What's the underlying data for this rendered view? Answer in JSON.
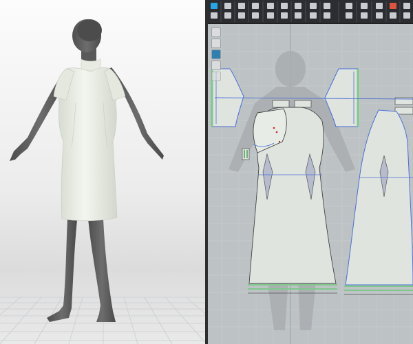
{
  "app": {
    "panels": [
      "3d-viewport",
      "2d-pattern-window"
    ]
  },
  "colors": {
    "viewport_bg_top": "#fcfcfc",
    "viewport_bg_bottom": "#e2e2e2",
    "avatar": "#5f5f5f",
    "garment": "#eef1e9",
    "pattern_bg": "#bdc2c4",
    "pattern_fill": "#dfe4df",
    "seam_blue": "#4a6fd6",
    "binding_green": "#7ec98a",
    "toolbar_bg": "#2b2d30"
  },
  "toolbar": {
    "icons": [
      "transform-pattern-icon",
      "edit-pattern-icon",
      "edit-curve-icon",
      "add-point-icon",
      "polygon-icon",
      "rectangle-icon",
      "circle-icon",
      "internal-polygon-icon",
      "internal-rectangle-icon",
      "dart-icon",
      "segment-sewing-icon",
      "free-sewing-icon",
      "fold-arrangement-icon",
      "pin-icon",
      "tack-icon",
      "topstitch-icon",
      "measure-icon",
      "seam-allowance-icon",
      "binding-icon",
      "symmetry-icon",
      "annotation-icon",
      "texture-edit-icon",
      "grading-icon",
      "settings-icon"
    ]
  },
  "side_tools": [
    "pencil-icon",
    "fabric-icon",
    "color-icon",
    "layer-icon",
    "trace-icon"
  ],
  "grid": {
    "on": true
  }
}
